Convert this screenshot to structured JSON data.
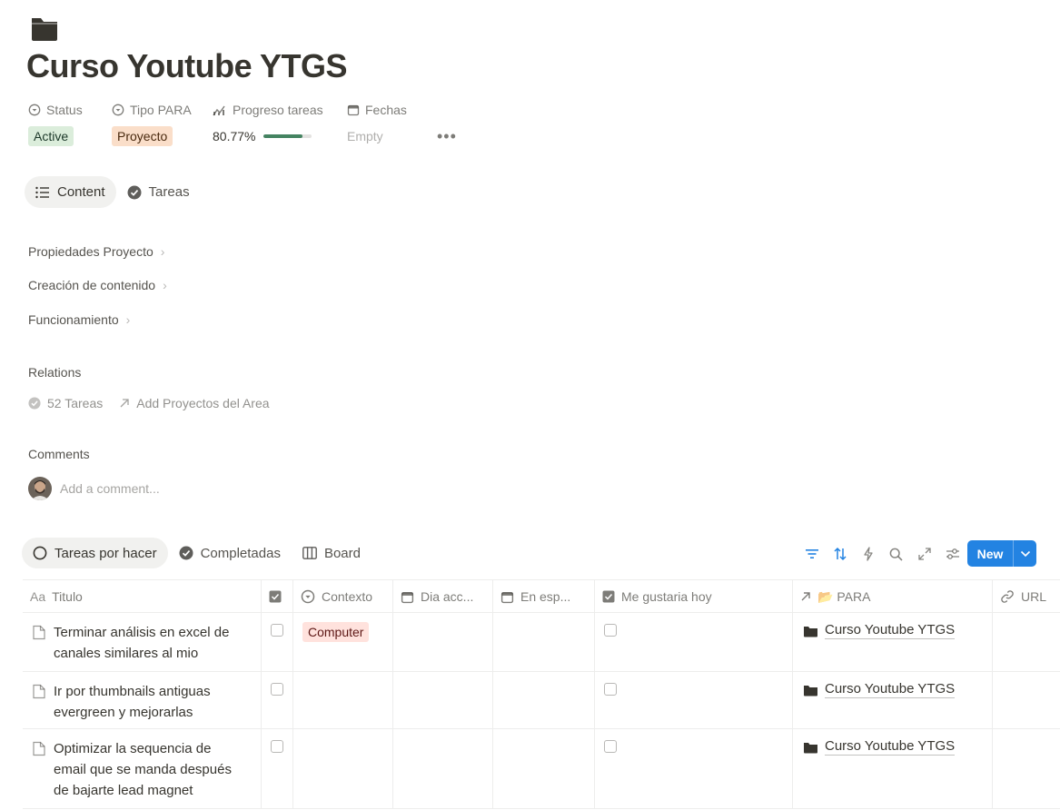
{
  "page": {
    "title": "Curso Youtube YTGS",
    "icon": "folder-icon"
  },
  "properties": {
    "status": {
      "name": "Status",
      "value": "Active"
    },
    "tipo_para": {
      "name": "Tipo PARA",
      "value": "Proyecto"
    },
    "progreso": {
      "name": "Progreso tareas",
      "value": "80.77%",
      "fraction": 0.8077
    },
    "fechas": {
      "name": "Fechas",
      "value": "Empty"
    },
    "more": "•••"
  },
  "tabs": [
    {
      "label": "Content",
      "icon": "list-icon",
      "active": true
    },
    {
      "label": "Tareas",
      "icon": "check-circle-icon",
      "active": false
    }
  ],
  "sections": [
    {
      "label": "Propiedades Proyecto"
    },
    {
      "label": "Creación de contenido"
    },
    {
      "label": "Funcionamiento"
    }
  ],
  "relations": {
    "heading": "Relations",
    "tareas": "52 Tareas",
    "add_proyectos": "Add Proyectos del Area"
  },
  "comments": {
    "heading": "Comments",
    "placeholder": "Add a comment..."
  },
  "views": [
    {
      "label": "Tareas por hacer",
      "icon": "circle-icon",
      "active": true
    },
    {
      "label": "Completadas",
      "icon": "check-circle-icon",
      "active": false
    },
    {
      "label": "Board",
      "icon": "board-icon",
      "active": false
    }
  ],
  "toolbar": {
    "new_label": "New"
  },
  "table": {
    "columns": [
      {
        "label": "Titulo",
        "icon": "text-icon"
      },
      {
        "label": "",
        "icon": "checkbox-icon"
      },
      {
        "label": "Contexto",
        "icon": "select-icon"
      },
      {
        "label": "Dia acc...",
        "icon": "calendar-icon"
      },
      {
        "label": "En esp...",
        "icon": "calendar-icon"
      },
      {
        "label": "Me gustaria hoy",
        "icon": "checkbox-icon"
      },
      {
        "label": "📂 PARA",
        "icon": "relation-arrow-icon"
      },
      {
        "label": "URL",
        "icon": "link-icon"
      }
    ],
    "rows": [
      {
        "title_lines": [
          "Terminar análisis en excel de",
          "canales similares al mio"
        ],
        "done": false,
        "contexto": "Computer",
        "me_gustaria": false,
        "para": "Curso Youtube YTGS"
      },
      {
        "title_lines": [
          "Ir por thumbnails antiguas",
          "evergreen y mejorarlas"
        ],
        "done": false,
        "contexto": "",
        "me_gustaria": false,
        "para": "Curso Youtube YTGS"
      },
      {
        "title_lines": [
          "Optimizar la sequencia de",
          "email que se manda después",
          "de bajarte lead magnet"
        ],
        "done": false,
        "contexto": "",
        "me_gustaria": false,
        "para": "Curso Youtube YTGS"
      }
    ]
  },
  "colors": {
    "accent": "#2383e2",
    "status_active_bg": "#dbeddb",
    "tipo_bg": "#fadec9",
    "progress": "#448361",
    "contexto_bg": "#fadec9"
  }
}
